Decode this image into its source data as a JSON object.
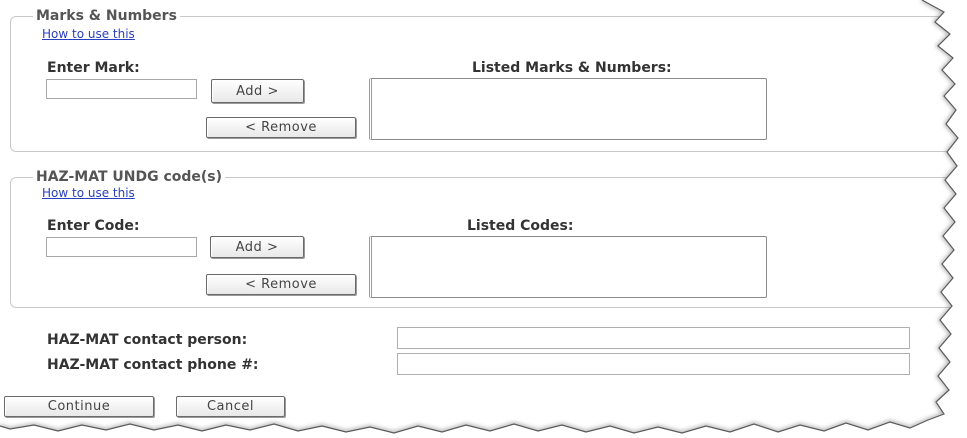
{
  "marks_section": {
    "legend": "Marks & Numbers",
    "help_link": "How to use this",
    "enter_label": "Enter Mark:",
    "list_label": "Listed Marks & Numbers:",
    "input_value": "",
    "add_label": "Add >",
    "remove_label": "< Remove",
    "listed_items": []
  },
  "hazmat_section": {
    "legend": "HAZ-MAT UNDG code(s)",
    "help_link": "How to use this",
    "enter_label": "Enter Code:",
    "list_label": "Listed Codes:",
    "input_value": "",
    "add_label": "Add >",
    "remove_label": "< Remove",
    "listed_items": []
  },
  "contact": {
    "person_label": "HAZ-MAT contact person:",
    "person_value": "",
    "phone_label": "HAZ-MAT contact phone #:",
    "phone_value": ""
  },
  "footer": {
    "continue_label": "Continue",
    "cancel_label": "Cancel"
  }
}
